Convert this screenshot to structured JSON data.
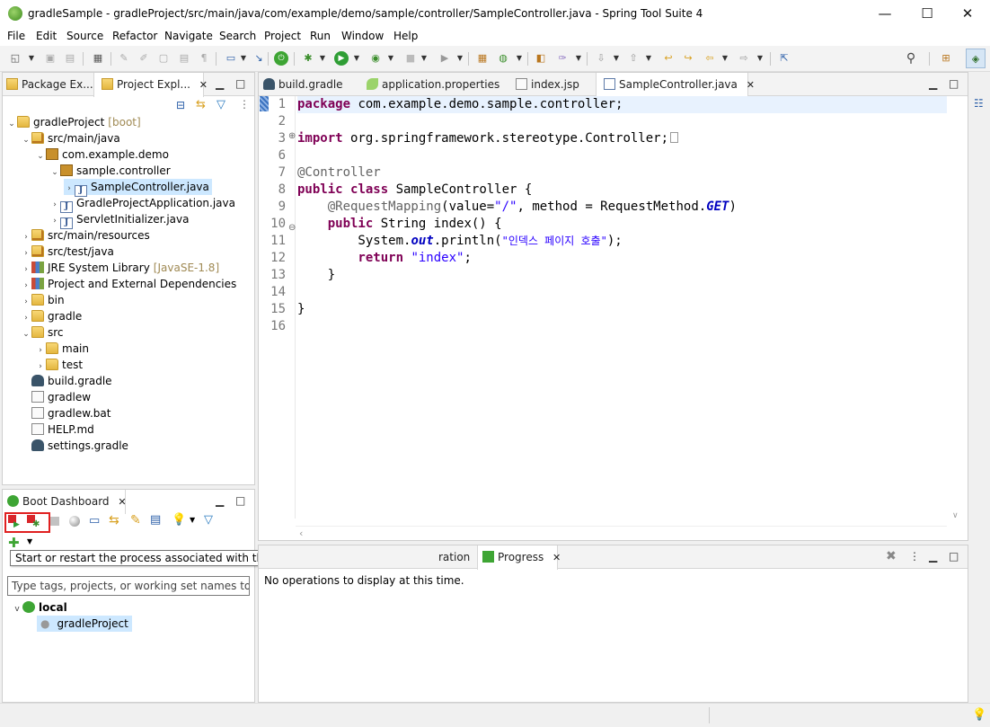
{
  "window": {
    "title": "gradleSample - gradleProject/src/main/java/com/example/demo/sample/controller/SampleController.java - Spring Tool Suite 4",
    "minimize": "—",
    "maximize": "☐",
    "close": "✕"
  },
  "menu": [
    "File",
    "Edit",
    "Source",
    "Refactor",
    "Navigate",
    "Search",
    "Project",
    "Run",
    "Window",
    "Help"
  ],
  "left_panel": {
    "tabs": [
      {
        "label": "Package Ex..."
      },
      {
        "label": "Project Expl..."
      }
    ],
    "close_icon": "✕"
  },
  "tree": [
    {
      "label": "gradleProject",
      "suffix": "[boot]",
      "icon": "project",
      "arrow": "v"
    },
    {
      "label": "src/main/java",
      "icon": "srcfolder",
      "arrow": "v"
    },
    {
      "label": "com.example.demo",
      "icon": "package",
      "arrow": "v"
    },
    {
      "label": "sample.controller",
      "icon": "package",
      "arrow": "v"
    },
    {
      "label": "SampleController.java",
      "icon": "java",
      "arrow": ">"
    },
    {
      "label": "GradleProjectApplication.java",
      "icon": "java",
      "arrow": ">"
    },
    {
      "label": "ServletInitializer.java",
      "icon": "java",
      "arrow": ">"
    },
    {
      "label": "src/main/resources",
      "icon": "srcfolder",
      "arrow": ">"
    },
    {
      "label": "src/test/java",
      "icon": "srcfolder",
      "arrow": ">"
    },
    {
      "label": "JRE System Library",
      "suffix": "[JavaSE-1.8]",
      "icon": "lib",
      "arrow": ">"
    },
    {
      "label": "Project and External Dependencies",
      "icon": "lib",
      "arrow": ">"
    },
    {
      "label": "bin",
      "icon": "folder",
      "arrow": ">"
    },
    {
      "label": "gradle",
      "icon": "folder",
      "arrow": ">"
    },
    {
      "label": "src",
      "icon": "folder",
      "arrow": "v"
    },
    {
      "label": "main",
      "icon": "folder",
      "arrow": ">"
    },
    {
      "label": "test",
      "icon": "folder",
      "arrow": ">"
    },
    {
      "label": "build.gradle",
      "icon": "gradle",
      "arrow": ""
    },
    {
      "label": "gradlew",
      "icon": "file",
      "arrow": ""
    },
    {
      "label": "gradlew.bat",
      "icon": "file",
      "arrow": ""
    },
    {
      "label": "HELP.md",
      "icon": "file",
      "arrow": ""
    },
    {
      "label": "settings.gradle",
      "icon": "gradle",
      "arrow": ""
    }
  ],
  "editor": {
    "tabs": [
      {
        "label": "build.gradle"
      },
      {
        "label": "application.properties"
      },
      {
        "label": "index.jsp"
      },
      {
        "label": "SampleController.java"
      }
    ],
    "line_numbers": [
      "1",
      "2",
      "3",
      "6",
      "7",
      "8",
      "9",
      "10",
      "11",
      "12",
      "13",
      "14",
      "15",
      "16"
    ],
    "code": {
      "l1_kw": "package",
      "l1_rest": " com.example.demo.sample.controller;",
      "l3_kw": "import",
      "l3_rest": " org.springframework.stereotype.Controller;",
      "l7": "@Controller",
      "l8_kw1": "public",
      "l8_kw2": "class",
      "l8_rest": " SampleController {",
      "l9_ann": "    @RequestMapping",
      "l9_a": "(value=",
      "l9_str": "\"/\"",
      "l9_b": ", method = RequestMethod.",
      "l9_fld": "GET",
      "l9_c": ")",
      "l10_kw": "    public",
      "l10_rest": " String index() {",
      "l11_a": "        System.",
      "l11_fld": "out",
      "l11_b": ".println(",
      "l11_str": "\"인덱스 페이지 호출\"",
      "l11_c": ");",
      "l12_kw": "        return",
      "l12_sp": " ",
      "l12_str": "\"index\"",
      "l12_c": ";",
      "l13": "    }",
      "l15": "}"
    }
  },
  "boot_dashboard": {
    "tab_label": "Boot Dashboard",
    "tooltip": "Start or restart the process associated with the selected elements (Ctrl+Alt+Shift+B, R)",
    "filter_placeholder": "Type tags, projects, or working set names to mat",
    "local_label": "local",
    "project_label": "gradleProject"
  },
  "bottom_panel": {
    "tab_partial": "ration",
    "progress_tab": "Progress",
    "message": "No operations to display at this time."
  },
  "colors": {
    "keyword": "#7f0055",
    "string": "#2a00ff",
    "annotation": "#646464",
    "field": "#0000c0",
    "highlight_box": "#e02020"
  }
}
